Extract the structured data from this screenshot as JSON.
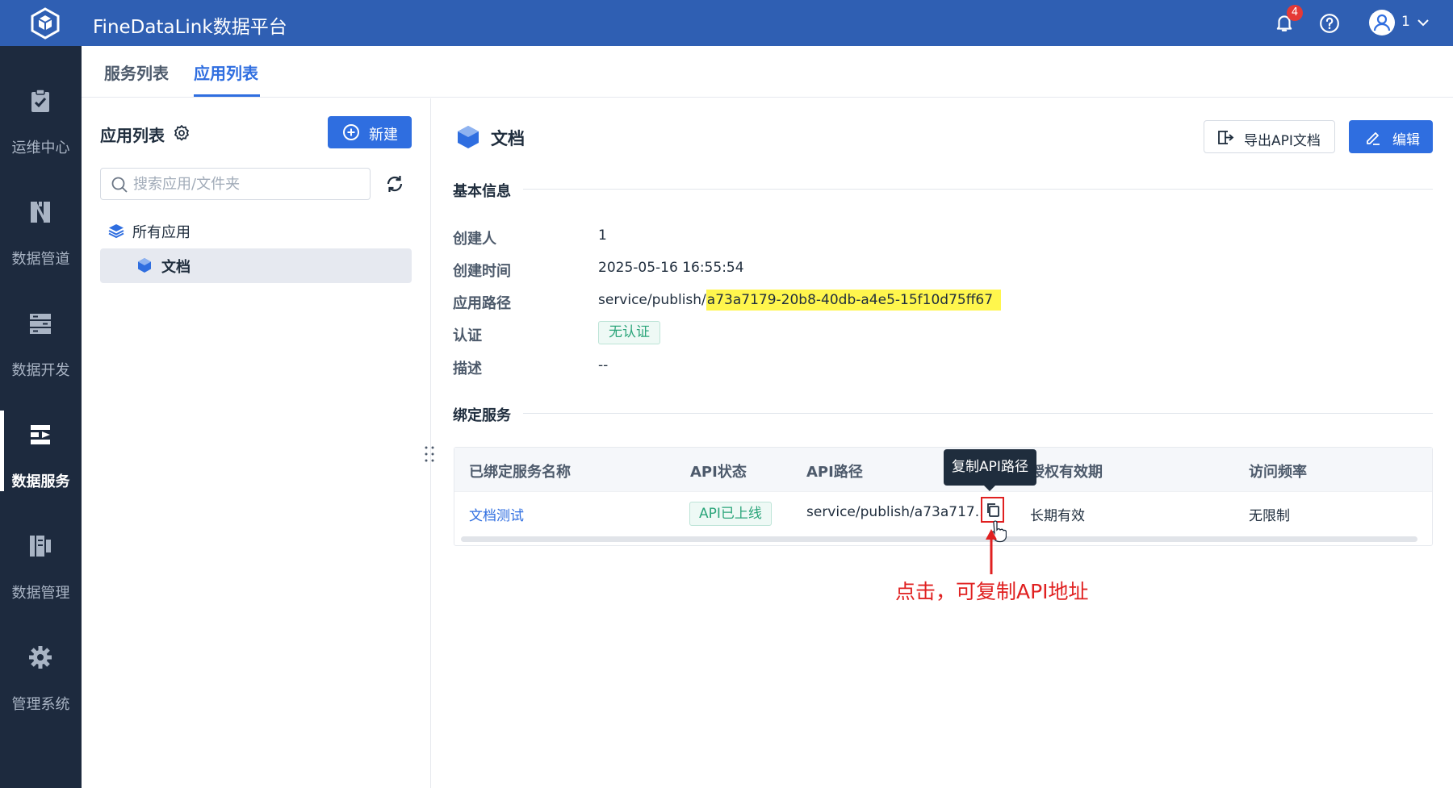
{
  "header": {
    "app_title": "FineDataLink数据平台",
    "notification_count": "4",
    "user_name": "1"
  },
  "nav": {
    "items": [
      {
        "label": "运维中心",
        "icon": "clipboard-check-icon"
      },
      {
        "label": "数据管道",
        "icon": "pipeline-icon"
      },
      {
        "label": "数据开发",
        "icon": "data-dev-icon"
      },
      {
        "label": "数据服务",
        "icon": "data-service-icon",
        "active": true
      },
      {
        "label": "数据管理",
        "icon": "data-manage-icon"
      },
      {
        "label": "管理系统",
        "icon": "gear-icon"
      }
    ]
  },
  "tabs": [
    {
      "label": "服务列表"
    },
    {
      "label": "应用列表",
      "active": true
    }
  ],
  "left_panel": {
    "title": "应用列表",
    "new_button": "新建",
    "search_placeholder": "搜索应用/文件夹",
    "tree": {
      "root": "所有应用",
      "items": [
        {
          "label": "文档",
          "selected": true
        }
      ]
    }
  },
  "main": {
    "title": "文档",
    "export_button": "导出API文档",
    "edit_button": "编辑",
    "basic_info": {
      "section_title": "基本信息",
      "creator_label": "创建人",
      "creator": "1",
      "created_time_label": "创建时间",
      "created_time": "2025-05-16 16:55:54",
      "path_label": "应用路径",
      "path_prefix": "service/publish/",
      "path_id": "a73a7179-20b8-40db-a4e5-15f10d75ff67",
      "auth_label": "认证",
      "auth_value": "无认证",
      "desc_label": "描述",
      "desc_value": "--"
    },
    "bound_services": {
      "section_title": "绑定服务",
      "columns": [
        "已绑定服务名称",
        "API状态",
        "API路径",
        "授权有效期",
        "访问频率"
      ],
      "rows": [
        {
          "name": "文档测试",
          "status": "API已上线",
          "path": "service/publish/a73a717...",
          "validity": "长期有效",
          "rate": "无限制"
        }
      ]
    },
    "tooltip": "复制API路径",
    "annotation": "点击，可复制API地址"
  },
  "colors": {
    "topbar": "#2f5fb3",
    "leftnav": "#1d2a3e",
    "primary": "#2f6ee0",
    "success": "#2ba57a",
    "highlight": "#fff64d",
    "annotation": "#e02020"
  }
}
